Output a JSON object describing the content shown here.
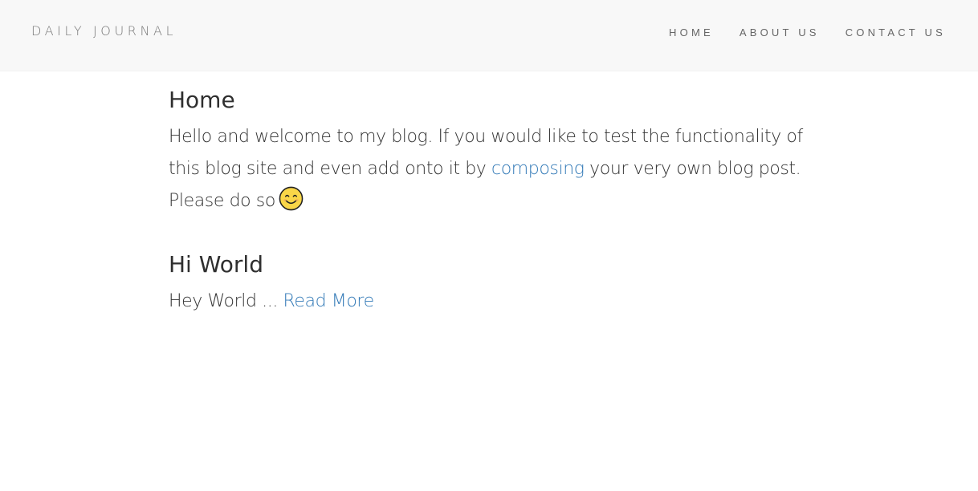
{
  "navbar": {
    "brand": "DAILY JOURNAL",
    "items": [
      {
        "label": "HOME"
      },
      {
        "label": "ABOUT US"
      },
      {
        "label": "CONTACT US"
      }
    ],
    "background_color": "#f8f8f8"
  },
  "home": {
    "title": "Home",
    "text_before_link": "Hello and welcome to my blog. If you would like to test the functionality of this blog site and even add onto it by ",
    "link_text": "composing",
    "text_after_link": " your very own blog post. Please do so",
    "emoji_icon": "smiling-face-icon"
  },
  "posts": [
    {
      "title": "Hi World",
      "excerpt": "Hey World ... ",
      "read_more": "Read More"
    }
  ],
  "colors": {
    "link": "#337ab7",
    "text": "#333333"
  }
}
